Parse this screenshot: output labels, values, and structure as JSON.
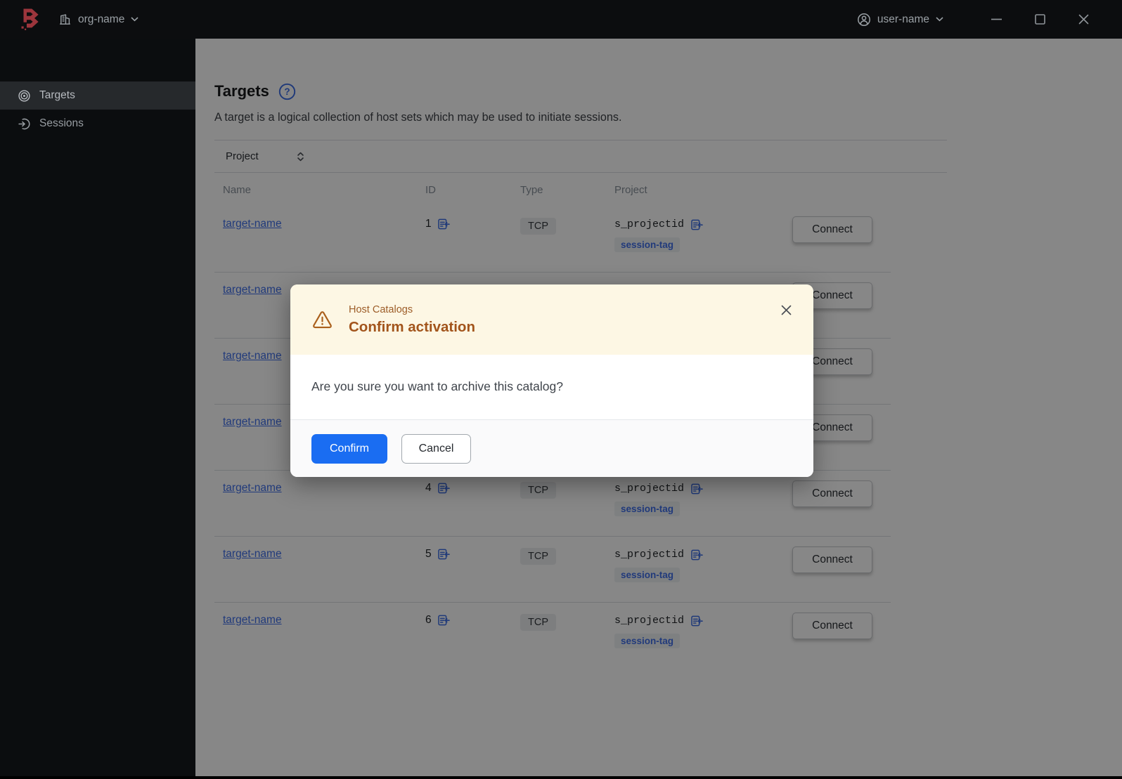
{
  "colors": {
    "accent_blue": "#1a6df2",
    "link_blue": "#3f6fe8",
    "brand_red": "#9c353c",
    "warning_fg": "#a2541b",
    "warning_bg": "#fdf7e4"
  },
  "topbar": {
    "org_name": "org-name",
    "user_name": "user-name"
  },
  "sidebar": {
    "items": [
      {
        "label": "Targets",
        "icon": "target-icon",
        "active": true
      },
      {
        "label": "Sessions",
        "icon": "entry-icon",
        "active": false
      }
    ]
  },
  "page": {
    "title": "Targets",
    "subtitle": "A target is a logical collection of host sets which may be used to initiate sessions."
  },
  "filter": {
    "label": "Project"
  },
  "table": {
    "headers": [
      "Name",
      "ID",
      "Type",
      "Project"
    ],
    "connect_label": "Connect",
    "rows": [
      {
        "name": "target-name",
        "id": "1",
        "type": "TCP",
        "project": "s_projectid",
        "tag": "session-tag"
      },
      {
        "name": "target-name",
        "id": "",
        "type": "",
        "project": "",
        "tag": ""
      },
      {
        "name": "target-name",
        "id": "",
        "type": "",
        "project": "",
        "tag": ""
      },
      {
        "name": "target-name",
        "id": "",
        "type": "",
        "project": "",
        "tag": ""
      },
      {
        "name": "target-name",
        "id": "4",
        "type": "TCP",
        "project": "s_projectid",
        "tag": "session-tag"
      },
      {
        "name": "target-name",
        "id": "5",
        "type": "TCP",
        "project": "s_projectid",
        "tag": "session-tag"
      },
      {
        "name": "target-name",
        "id": "6",
        "type": "TCP",
        "project": "s_projectid",
        "tag": "session-tag"
      }
    ]
  },
  "modal": {
    "eyebrow": "Host Catalogs",
    "title": "Confirm activation",
    "message": "Are you sure you want to archive this catalog?",
    "confirm_label": "Confirm",
    "cancel_label": "Cancel"
  }
}
